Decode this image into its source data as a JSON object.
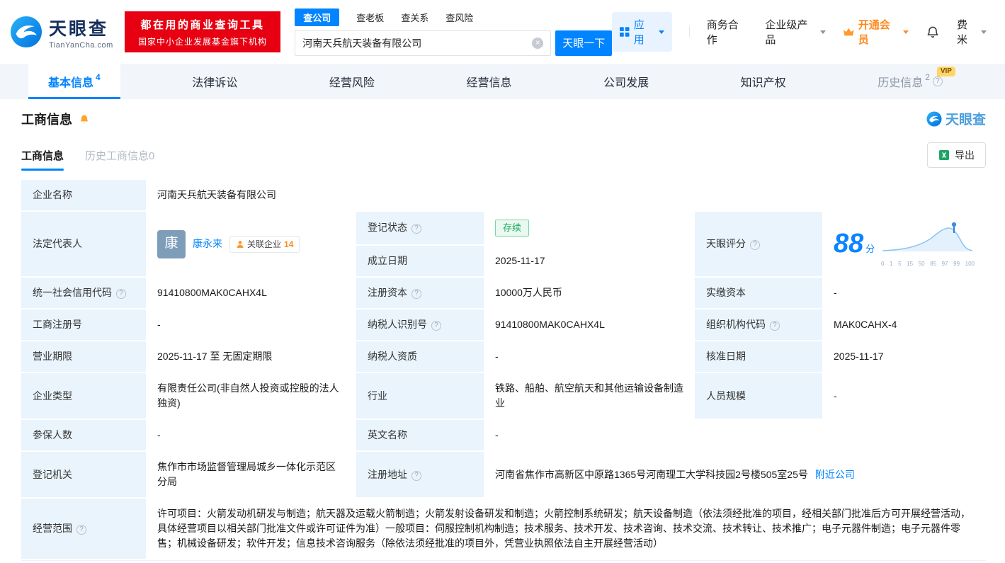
{
  "brand": {
    "logo_title": "天眼查",
    "logo_domain": "TianYanCha.com",
    "blue": "#0084ff",
    "red": "#e60012",
    "orange": "#ff8a1e",
    "green": "#19a862"
  },
  "header": {
    "ad": {
      "line1": "都在用的商业查询工具",
      "line2": "国家中小企业发展基金旗下机构"
    },
    "search": {
      "tabs": [
        {
          "label": "查公司"
        },
        {
          "label": "查老板"
        },
        {
          "label": "查关系"
        },
        {
          "label": "查风险"
        }
      ],
      "value": "河南天兵航天装备有限公司",
      "button": "天眼一下"
    },
    "menu": {
      "apps": "应用",
      "cooperation": "商务合作",
      "enterprise": "企业级产品",
      "vip": "开通会员",
      "user": "费米"
    }
  },
  "nav": {
    "tabs": [
      {
        "label": "基本信息",
        "badge": "4"
      },
      {
        "label": "法律诉讼"
      },
      {
        "label": "经营风险"
      },
      {
        "label": "经营信息"
      },
      {
        "label": "公司发展"
      },
      {
        "label": "知识产权"
      },
      {
        "label": "历史信息",
        "badge": "2",
        "vip": "VIP"
      }
    ]
  },
  "section": {
    "title": "工商信息",
    "watermark": "天眼查",
    "tab_current": "工商信息",
    "tab_history": "历史工商信息0",
    "export": "导出"
  },
  "biz": {
    "name": {
      "label": "企业名称",
      "value": "河南天兵航天装备有限公司"
    },
    "legal": {
      "label": "法定代表人",
      "avatar": "康",
      "person": "康永来",
      "related_label": "关联企业",
      "related_count": "14"
    },
    "status": {
      "label": "登记状态",
      "value": "存续"
    },
    "established": {
      "label": "成立日期",
      "value": "2025-11-17"
    },
    "score": {
      "label": "天眼评分",
      "value": "88",
      "unit": "分",
      "ticks": [
        "0",
        "1",
        "5",
        "15",
        "50",
        "85",
        "97",
        "99",
        "100"
      ]
    },
    "credit_code": {
      "label": "统一社会信用代码",
      "value": "91410800MAK0CAHX4L"
    },
    "reg_capital": {
      "label": "注册资本",
      "value": "10000万人民币"
    },
    "paid_capital": {
      "label": "实缴资本",
      "value": "-"
    },
    "reg_number": {
      "label": "工商注册号",
      "value": "-"
    },
    "taxpayer_id": {
      "label": "纳税人识别号",
      "value": "91410800MAK0CAHX4L"
    },
    "org_code": {
      "label": "组织机构代码",
      "value": "MAK0CAHX-4"
    },
    "term": {
      "label": "营业期限",
      "value": "2025-11-17 至 无固定期限"
    },
    "taxpayer_quality": {
      "label": "纳税人资质",
      "value": "-"
    },
    "approval_date": {
      "label": "核准日期",
      "value": "2025-11-17"
    },
    "company_type": {
      "label": "企业类型",
      "value": "有限责任公司(非自然人投资或控股的法人独资)"
    },
    "industry": {
      "label": "行业",
      "value": "铁路、船舶、航空航天和其他运输设备制造业"
    },
    "staff_size": {
      "label": "人员规模",
      "value": "-"
    },
    "insured": {
      "label": "参保人数",
      "value": "-"
    },
    "english_name": {
      "label": "英文名称",
      "value": "-"
    },
    "authority": {
      "label": "登记机关",
      "value": "焦作市市场监督管理局城乡一体化示范区分局"
    },
    "address": {
      "label": "注册地址",
      "value": "河南省焦作市高新区中原路1365号河南理工大学科技园2号楼505室25号",
      "nearby": "附近公司"
    },
    "scope": {
      "label": "经营范围",
      "value": "许可项目：火箭发动机研发与制造；航天器及运载火箭制造；火箭发射设备研发和制造；火箭控制系统研发；航天设备制造（依法须经批准的项目，经相关部门批准后方可开展经营活动，具体经营项目以相关部门批准文件或许可证件为准）一般项目：伺服控制机构制造；技术服务、技术开发、技术咨询、技术交流、技术转让、技术推广；电子元器件制造；电子元器件零售；机械设备研发；软件开发；信息技术咨询服务（除依法须经批准的项目外，凭营业执照依法自主开展经营活动）"
    }
  }
}
